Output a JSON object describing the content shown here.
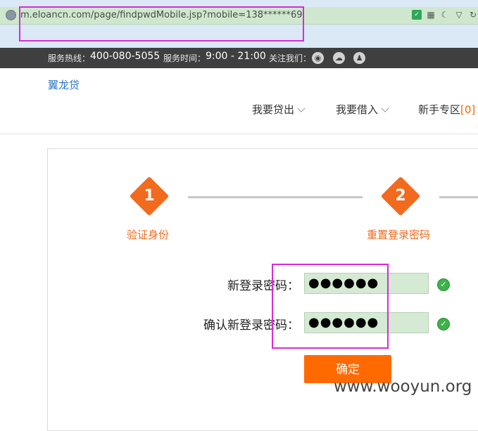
{
  "browser": {
    "url": "m.eloancn.com/page/findpwdMobile.jsp?mobile=138******69"
  },
  "topbar": {
    "hotline_label": "服务热线：",
    "hotline_value": "400-080-5055",
    "hours_label": "服务时间：",
    "hours_value": "9:00 - 21:00",
    "follow_label": "关注我们："
  },
  "header": {
    "logo": "翼龙贷",
    "nav": [
      {
        "label": "我要贷出"
      },
      {
        "label": "我要借入"
      },
      {
        "label": "新手专区",
        "badge": "[0]"
      }
    ]
  },
  "steps": [
    {
      "num": "1",
      "label": "验证身份"
    },
    {
      "num": "2",
      "label": "重置登录密码"
    }
  ],
  "form": {
    "new_password_label": "新登录密码：",
    "new_password_value": "●●●●●●",
    "confirm_password_label": "确认新登录密码：",
    "confirm_password_value": "●●●●●●",
    "submit_label": "确定"
  },
  "watermark": "www.wooyun.org",
  "colors": {
    "accent": "#f26a1e",
    "button": "#ff6a00",
    "highlight": "#d82bd8",
    "field_bg": "#d4ead3"
  }
}
